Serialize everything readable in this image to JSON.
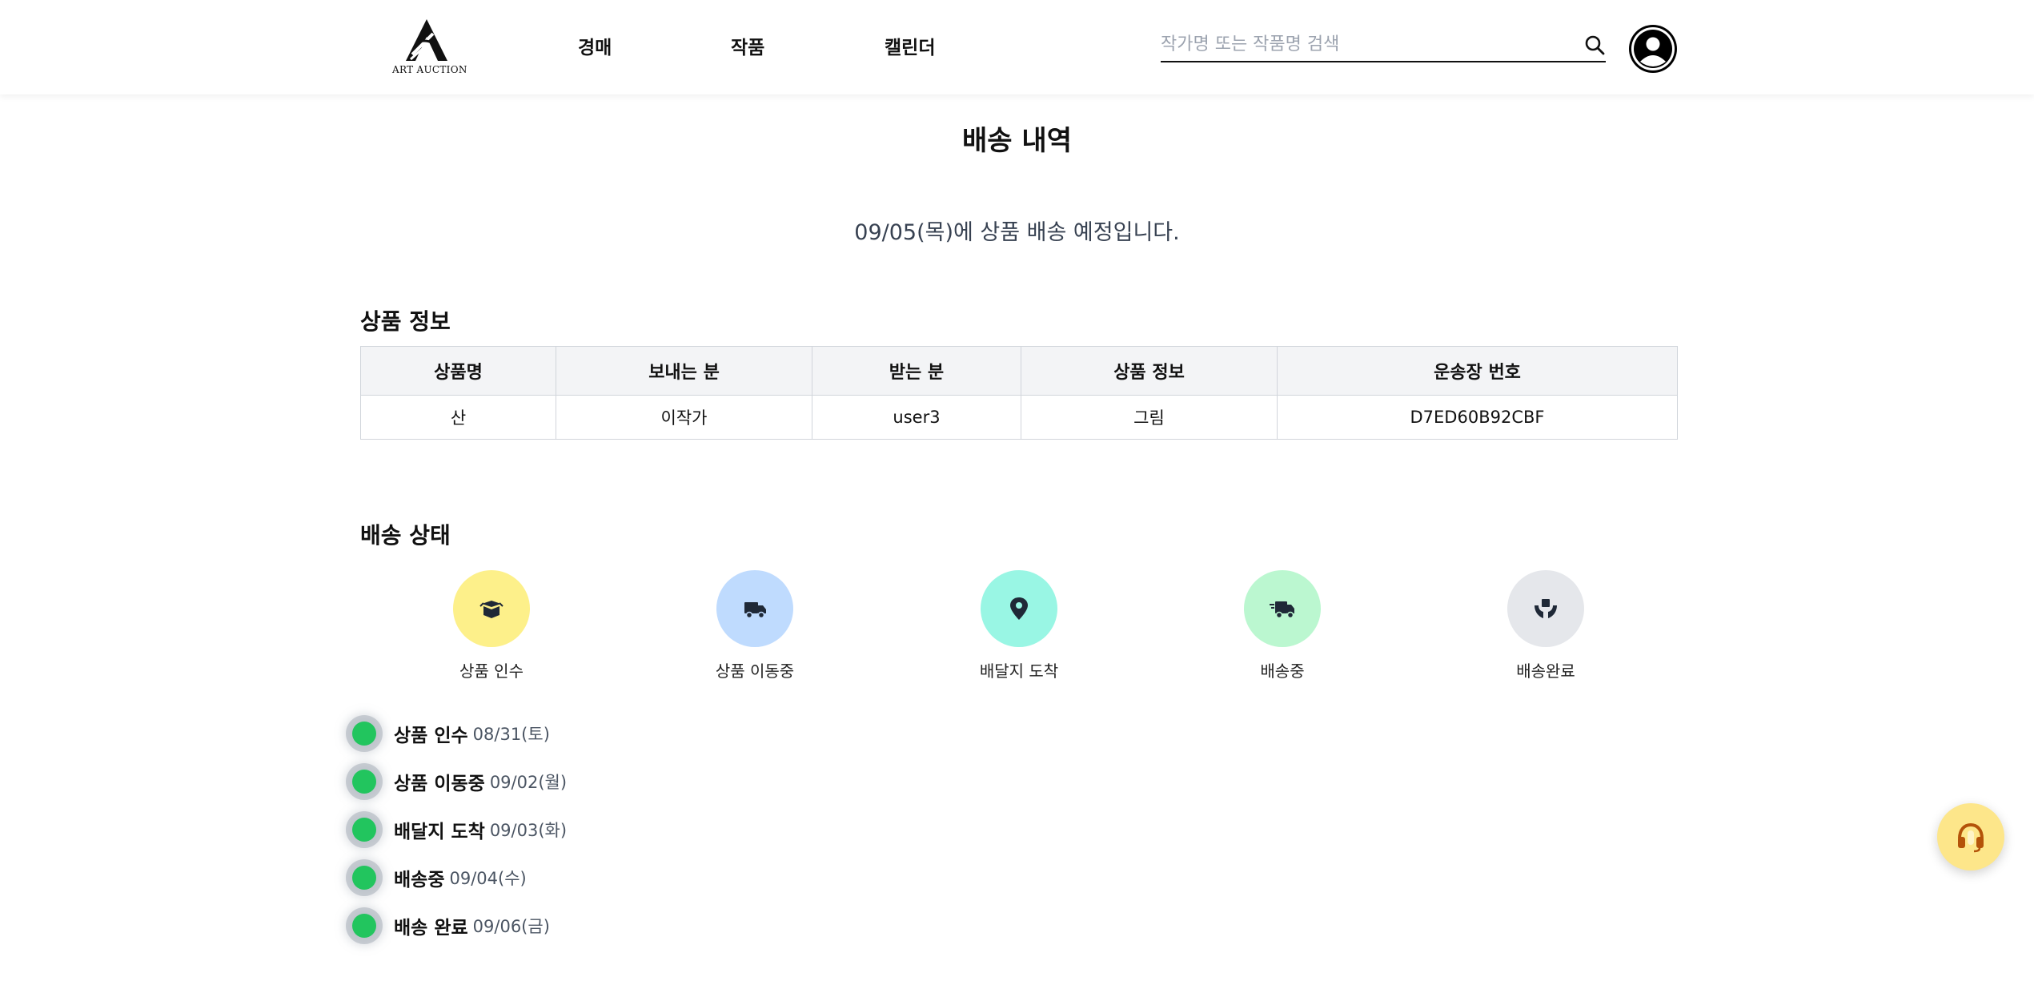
{
  "header": {
    "logo_text": "ART AUCTION",
    "nav": [
      {
        "label": "경매"
      },
      {
        "label": "작품"
      },
      {
        "label": "캘린더"
      }
    ],
    "search": {
      "placeholder": "작가명 또는 작품명 검색",
      "value": ""
    }
  },
  "main": {
    "title": "배송 내역",
    "notice": "09/05(목)에 상품 배송 예정입니다.",
    "product_section": {
      "title": "상품 정보",
      "columns": [
        "상품명",
        "보내는 분",
        "받는 분",
        "상품 정보",
        "운송장 번호"
      ],
      "row": [
        "산",
        "이작가",
        "user3",
        "그림",
        "D7ED60B92CBF"
      ]
    },
    "status_section": {
      "title": "배송 상태",
      "steps": [
        {
          "label": "상품 인수",
          "icon": "box-open-icon",
          "color": "#fdf08a"
        },
        {
          "label": "상품 이동중",
          "icon": "truck-icon",
          "color": "#bfdbfe"
        },
        {
          "label": "배달지 도착",
          "icon": "location-pin-icon",
          "color": "#99f6e4"
        },
        {
          "label": "배송중",
          "icon": "truck-fast-icon",
          "color": "#bbf7d0"
        },
        {
          "label": "배송완료",
          "icon": "hand-holding-box-icon",
          "color": "#e5e7eb"
        }
      ],
      "timeline": [
        {
          "label": "상품 인수",
          "date": "08/31(토)"
        },
        {
          "label": "상품 이동중",
          "date": "09/02(월)"
        },
        {
          "label": "배달지 도착",
          "date": "09/03(화)"
        },
        {
          "label": "배송중",
          "date": "09/04(수)"
        },
        {
          "label": "배송 완료",
          "date": "09/06(금)"
        }
      ]
    }
  },
  "support_button": {
    "icon": "headset-icon",
    "color": "#fde68a"
  }
}
